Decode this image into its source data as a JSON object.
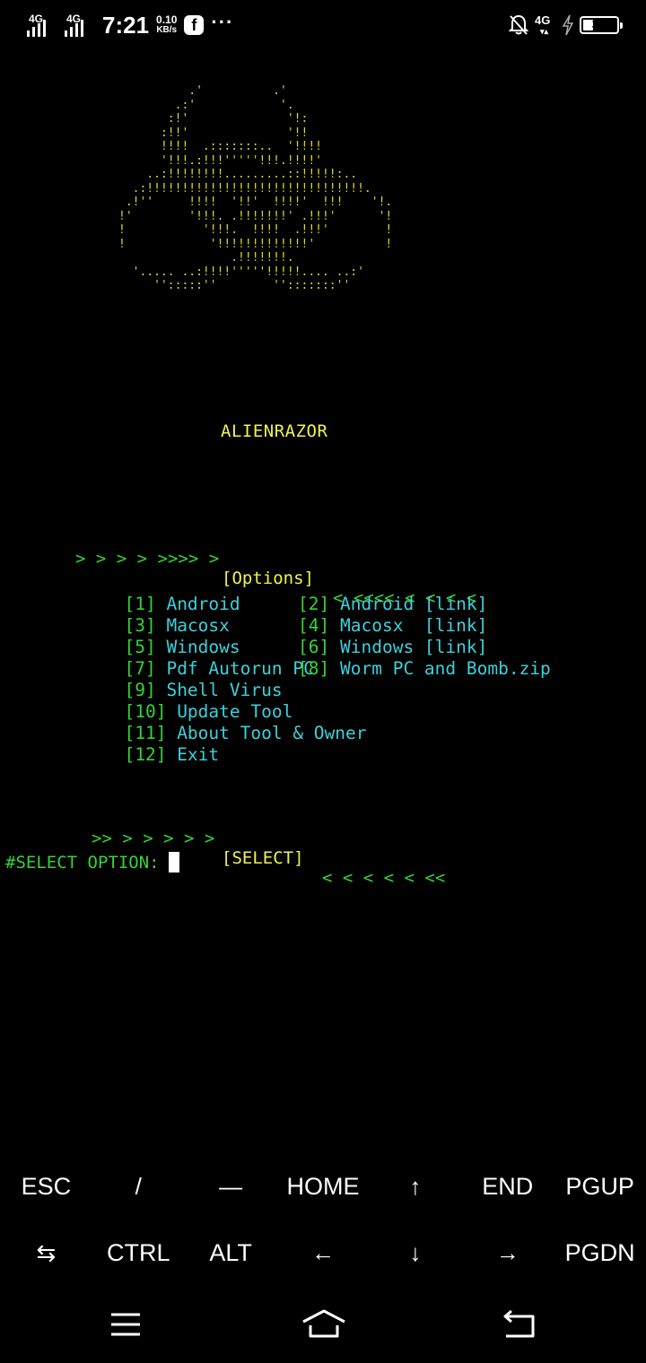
{
  "status_bar": {
    "signal1_label": "4G",
    "signal2_label": "4G",
    "time": "7:21",
    "speed_value": "0.10",
    "speed_unit": "KB/s",
    "app_icon": "facebook-icon",
    "more_icon": "more-dots-icon",
    "network_label": "4G",
    "battery_level": "37",
    "battery_fraction": 0.37
  },
  "terminal": {
    "ascii_art": "          .'          .'\n        .:'            '.\n       :!'              '!:\n      :!!'              '!!\n      !!!!  .:::::::..  '!!!!\n      '!!!.:!!!'''''!!!.!!!!'\n    ..:!!!!!!!!.........::!!!!!:..\n  .:!!!!!!!!!!!!!!!!!!!!!!!!!!!!!!!.\n .!''     !!!!  '!!'  !!!!'  !!!    '!.\n!'        '!!!. .!!!!!!!' .!!!'      '!\n!           '!!!.  !!!!  .!!!'        !\n!            '!!!!!!!!!!!!!'          !\n                .!!!!!!!.\n  '..... ..:!!!!'''''!!!!!.... ..:'\n     '':::::''        '':::::::''",
    "brand": "ALIENRAZOR",
    "options_banner": {
      "left": "> > > > >>>> >",
      "label": "[Options]",
      "right": "< <<<< < < < <"
    },
    "menu": [
      {
        "num": "1",
        "label": "Android"
      },
      {
        "num": "2",
        "label": "Android [link]"
      },
      {
        "num": "3",
        "label": "Macosx"
      },
      {
        "num": "4",
        "label": "Macosx  [link]"
      },
      {
        "num": "5",
        "label": "Windows"
      },
      {
        "num": "6",
        "label": "Windows [link]"
      },
      {
        "num": "7",
        "label": "Pdf Autorun PC"
      },
      {
        "num": "8",
        "label": "Worm PC and Bomb.zip"
      },
      {
        "num": "9",
        "label": "Shell Virus"
      },
      {
        "num": "10",
        "label": "Update Tool"
      },
      {
        "num": "11",
        "label": "About Tool & Owner"
      },
      {
        "num": "12",
        "label": "Exit"
      }
    ],
    "select_banner": {
      "left": ">> > > > > >",
      "label": "[SELECT]",
      "right": "< < < < < <<"
    },
    "prompt": "#SELECT OPTION:"
  },
  "extra_keys": {
    "row1": [
      "ESC",
      "/",
      "—",
      "HOME",
      "↑",
      "END",
      "PGUP"
    ],
    "row2": [
      "⇆",
      "CTRL",
      "ALT",
      "←",
      "↓",
      "→",
      "PGDN"
    ]
  },
  "nav_bar": {
    "menu_icon": "menu-lines-icon",
    "home_icon": "home-icon",
    "back_icon": "back-icon"
  }
}
